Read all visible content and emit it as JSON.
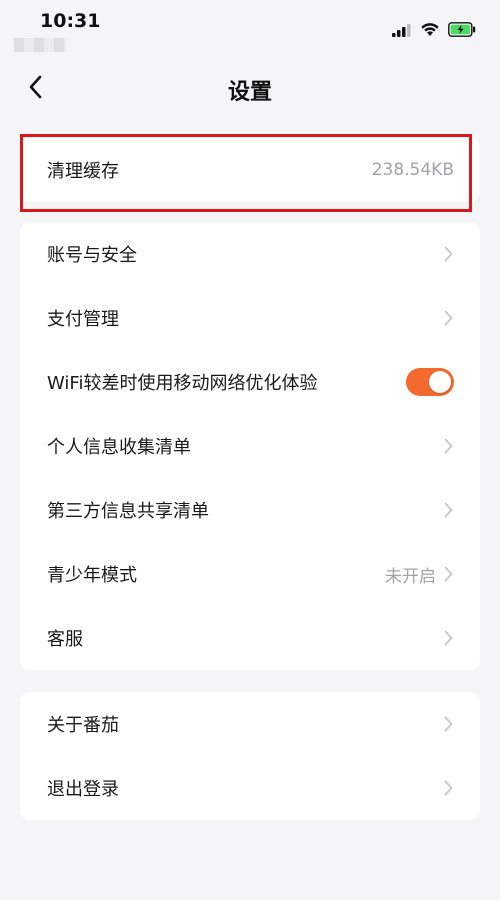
{
  "status_bar": {
    "time": "10:31",
    "battery_color": "#4cd964"
  },
  "nav": {
    "back_icon": "chevron-left-icon",
    "title": "设置"
  },
  "cache_row": {
    "label": "清理缓存",
    "value": "238.54KB"
  },
  "main_group": {
    "items": [
      {
        "label": "账号与安全",
        "value": ""
      },
      {
        "label": "支付管理",
        "value": ""
      },
      {
        "label": "WiFi较差时使用移动网络优化体验",
        "toggle_on": true
      },
      {
        "label": "个人信息收集清单",
        "value": ""
      },
      {
        "label": "第三方信息共享清单",
        "value": ""
      },
      {
        "label": "青少年模式",
        "value": "未开启"
      },
      {
        "label": "客服",
        "value": ""
      }
    ]
  },
  "bottom_group": {
    "items": [
      {
        "label": "关于番茄"
      },
      {
        "label": "退出登录"
      }
    ]
  },
  "colors": {
    "accent_toggle": "#f46a2e",
    "highlight_border": "#d7191e",
    "background": "#f5f5f7",
    "chevron": "#c7c7cc"
  }
}
